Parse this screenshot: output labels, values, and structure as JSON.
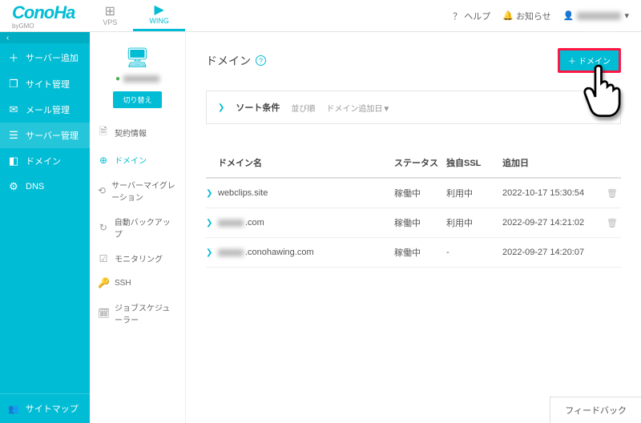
{
  "logo": {
    "main": "ConoHa",
    "sub": "byGMO"
  },
  "topTabs": [
    {
      "label": "VPS",
      "icon": "⊞"
    },
    {
      "label": "WING",
      "icon": "▶"
    }
  ],
  "topRight": {
    "help": "ヘルプ",
    "news": "お知らせ"
  },
  "sidebar": {
    "items": [
      {
        "icon": "＋",
        "label": "サーバー追加"
      },
      {
        "icon": "❐",
        "label": "サイト管理"
      },
      {
        "icon": "✉",
        "label": "メール管理"
      },
      {
        "icon": "☰",
        "label": "サーバー管理"
      },
      {
        "icon": "◧",
        "label": "ドメイン"
      },
      {
        "icon": "⚙",
        "label": "DNS"
      }
    ],
    "footer": {
      "icon": "👥",
      "label": "サイトマップ"
    }
  },
  "serverBox": {
    "switch": "切り替え"
  },
  "subSidebar": [
    {
      "icon": "🗎",
      "label": "契約情報"
    },
    {
      "icon": "⊕",
      "label": "ドメイン"
    },
    {
      "icon": "⟲",
      "label": "サーバーマイグレーション"
    },
    {
      "icon": "↻",
      "label": "自動バックアップ"
    },
    {
      "icon": "☑",
      "label": "モニタリング"
    },
    {
      "icon": "🔑",
      "label": "SSH"
    },
    {
      "icon": "🗓",
      "label": "ジョブスケジューラー"
    }
  ],
  "main": {
    "title": "ドメイン",
    "addBtn": "ドメイン",
    "sort": {
      "label": "ソート条件",
      "order": "並び順",
      "by": "ドメイン追加日▼"
    }
  },
  "table": {
    "headers": {
      "domain": "ドメイン名",
      "status": "ステータス",
      "ssl": "独自SSL",
      "added": "追加日"
    },
    "rows": [
      {
        "domain": "webclips.site",
        "masked": false,
        "status": "稼働中",
        "ssl": "利用中",
        "added": "2022-10-17 15:30:54",
        "trash": true
      },
      {
        "domain": ".com",
        "masked": true,
        "status": "稼働中",
        "ssl": "利用中",
        "added": "2022-09-27 14:21:02",
        "trash": true
      },
      {
        "domain": ".conohawing.com",
        "masked": true,
        "status": "稼働中",
        "ssl": "-",
        "added": "2022-09-27 14:20:07",
        "trash": false
      }
    ]
  },
  "feedback": "フィードバック"
}
